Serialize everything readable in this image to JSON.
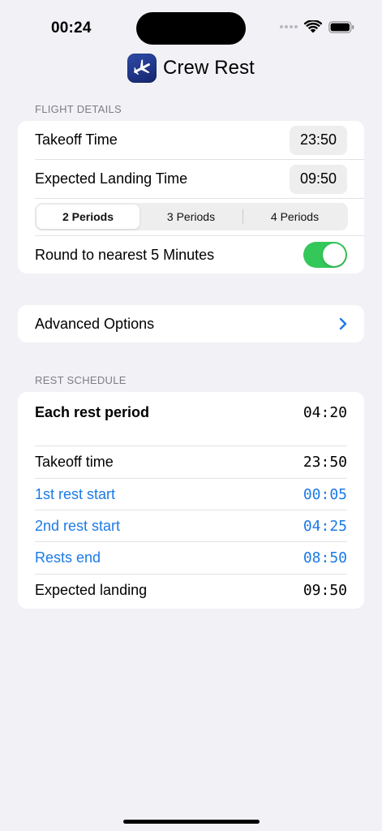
{
  "status_bar": {
    "time": "00:24"
  },
  "app": {
    "title": "Crew Rest"
  },
  "flight_details": {
    "section_label": "FLIGHT DETAILS",
    "takeoff_label": "Takeoff Time",
    "takeoff_value": "23:50",
    "landing_label": "Expected Landing Time",
    "landing_value": "09:50",
    "periods": [
      "2 Periods",
      "3 Periods",
      "4 Periods"
    ],
    "selected_period": "2 Periods",
    "round_label": "Round to nearest 5 Minutes",
    "round_enabled": true
  },
  "advanced": {
    "label": "Advanced Options"
  },
  "rest_schedule": {
    "section_label": "REST SCHEDULE",
    "each_rest_label": "Each rest period",
    "each_rest_value": "04:20",
    "rows": [
      {
        "label": "Takeoff time",
        "value": "23:50"
      },
      {
        "label": "1st rest start",
        "value": "00:05"
      },
      {
        "label": "2nd rest start",
        "value": "04:25"
      },
      {
        "label": "Rests end",
        "value": "08:50"
      },
      {
        "label": "Expected landing",
        "value": "09:50"
      }
    ]
  },
  "colors": {
    "accent_blue": "#1c7ae6",
    "toggle_green": "#34c759",
    "background": "#f2f1f6"
  }
}
